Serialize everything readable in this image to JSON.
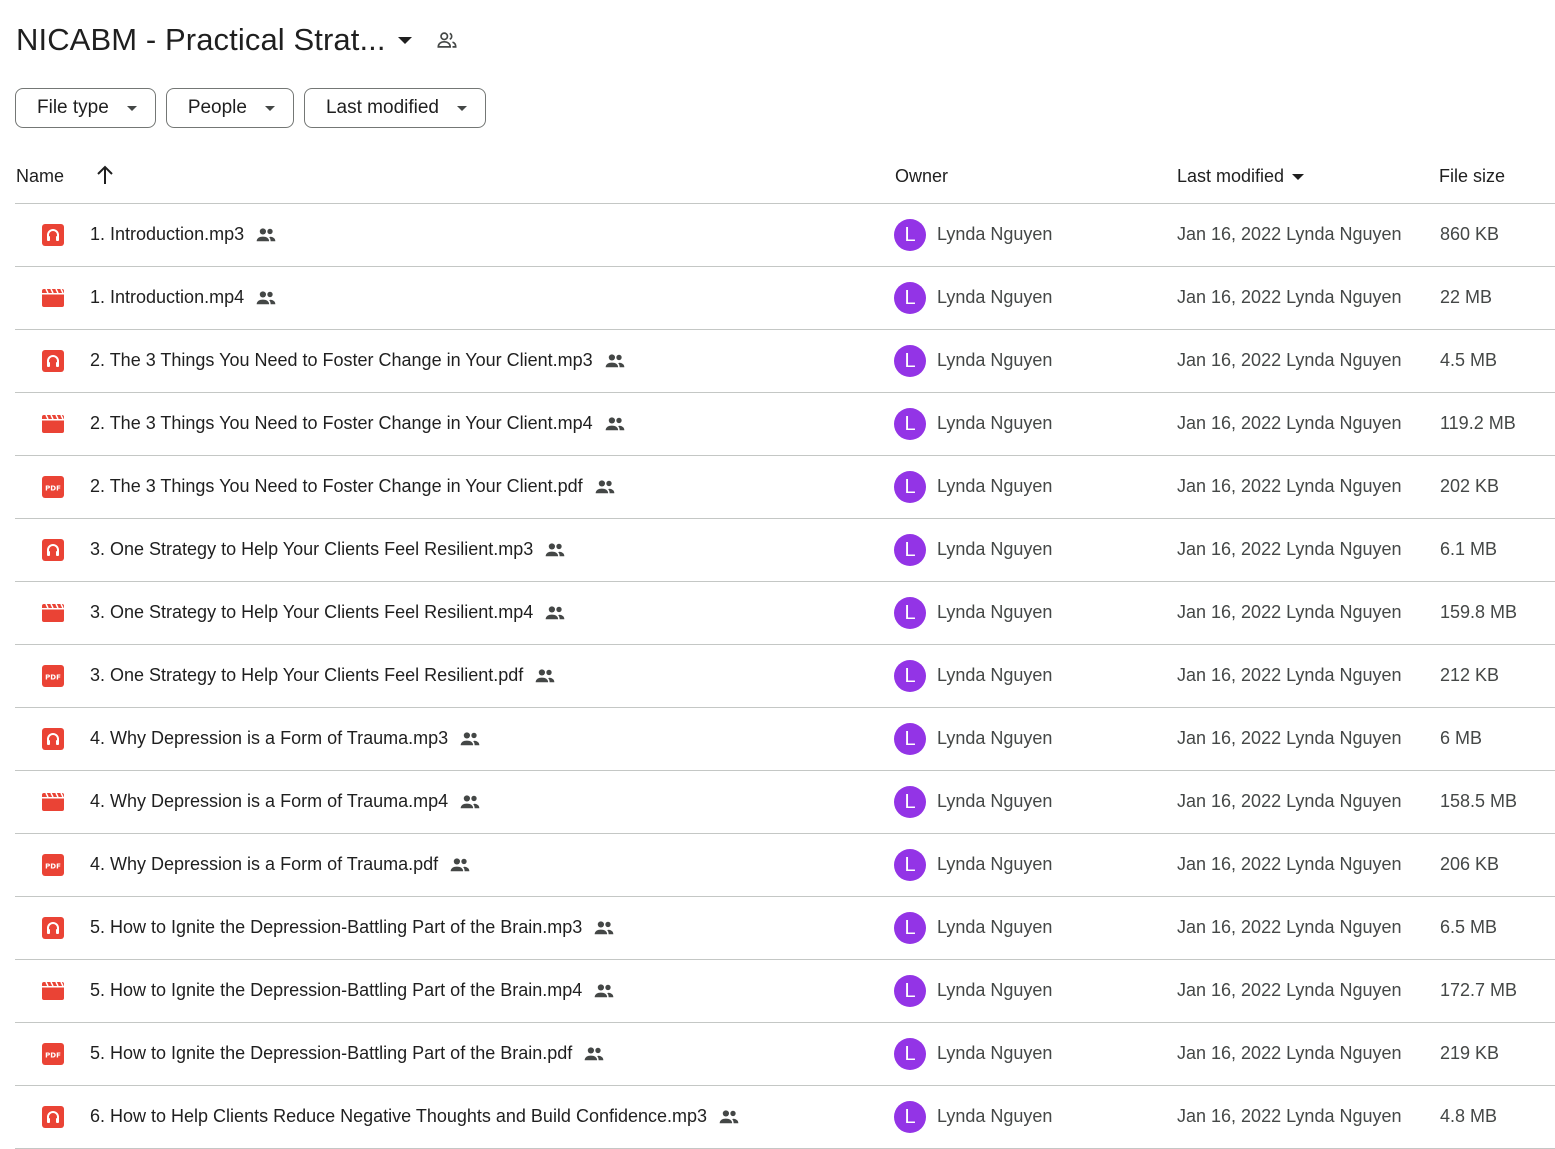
{
  "folder": {
    "title": "NICABM - Practical Strat..."
  },
  "filters": [
    {
      "label": "File type"
    },
    {
      "label": "People"
    },
    {
      "label": "Last modified"
    }
  ],
  "columns": {
    "name": "Name",
    "owner": "Owner",
    "last_modified": "Last modified",
    "file_size": "File size"
  },
  "colors": {
    "accent_red": "#ea4335",
    "avatar_purple": "#9334e6"
  },
  "files": [
    {
      "name": "1. Introduction.mp3",
      "type": "audio",
      "owner_initial": "L",
      "owner": "Lynda Nguyen",
      "modified": "Jan 16, 2022 Lynda Nguyen",
      "size": "860 KB"
    },
    {
      "name": "1. Introduction.mp4",
      "type": "video",
      "owner_initial": "L",
      "owner": "Lynda Nguyen",
      "modified": "Jan 16, 2022 Lynda Nguyen",
      "size": "22 MB"
    },
    {
      "name": "2. The 3 Things You Need to Foster Change in Your Client.mp3",
      "type": "audio",
      "owner_initial": "L",
      "owner": "Lynda Nguyen",
      "modified": "Jan 16, 2022 Lynda Nguyen",
      "size": "4.5 MB"
    },
    {
      "name": "2. The 3 Things You Need to Foster Change in Your Client.mp4",
      "type": "video",
      "owner_initial": "L",
      "owner": "Lynda Nguyen",
      "modified": "Jan 16, 2022 Lynda Nguyen",
      "size": "119.2 MB"
    },
    {
      "name": "2. The 3 Things You Need to Foster Change in Your Client.pdf",
      "type": "pdf",
      "owner_initial": "L",
      "owner": "Lynda Nguyen",
      "modified": "Jan 16, 2022 Lynda Nguyen",
      "size": "202 KB"
    },
    {
      "name": "3. One Strategy to Help Your Clients Feel Resilient.mp3",
      "type": "audio",
      "owner_initial": "L",
      "owner": "Lynda Nguyen",
      "modified": "Jan 16, 2022 Lynda Nguyen",
      "size": "6.1 MB"
    },
    {
      "name": "3. One Strategy to Help Your Clients Feel Resilient.mp4",
      "type": "video",
      "owner_initial": "L",
      "owner": "Lynda Nguyen",
      "modified": "Jan 16, 2022 Lynda Nguyen",
      "size": "159.8 MB"
    },
    {
      "name": "3. One Strategy to Help Your Clients Feel Resilient.pdf",
      "type": "pdf",
      "owner_initial": "L",
      "owner": "Lynda Nguyen",
      "modified": "Jan 16, 2022 Lynda Nguyen",
      "size": "212 KB"
    },
    {
      "name": "4. Why Depression is a Form of Trauma.mp3",
      "type": "audio",
      "owner_initial": "L",
      "owner": "Lynda Nguyen",
      "modified": "Jan 16, 2022 Lynda Nguyen",
      "size": "6 MB"
    },
    {
      "name": "4. Why Depression is a Form of Trauma.mp4",
      "type": "video",
      "owner_initial": "L",
      "owner": "Lynda Nguyen",
      "modified": "Jan 16, 2022 Lynda Nguyen",
      "size": "158.5 MB"
    },
    {
      "name": "4. Why Depression is a Form of Trauma.pdf",
      "type": "pdf",
      "owner_initial": "L",
      "owner": "Lynda Nguyen",
      "modified": "Jan 16, 2022 Lynda Nguyen",
      "size": "206 KB"
    },
    {
      "name": "5. How to Ignite the Depression-Battling Part of the Brain.mp3",
      "type": "audio",
      "owner_initial": "L",
      "owner": "Lynda Nguyen",
      "modified": "Jan 16, 2022 Lynda Nguyen",
      "size": "6.5 MB"
    },
    {
      "name": "5. How to Ignite the Depression-Battling Part of the Brain.mp4",
      "type": "video",
      "owner_initial": "L",
      "owner": "Lynda Nguyen",
      "modified": "Jan 16, 2022 Lynda Nguyen",
      "size": "172.7 MB"
    },
    {
      "name": "5. How to Ignite the Depression-Battling Part of the Brain.pdf",
      "type": "pdf",
      "owner_initial": "L",
      "owner": "Lynda Nguyen",
      "modified": "Jan 16, 2022 Lynda Nguyen",
      "size": "219 KB"
    },
    {
      "name": "6. How to Help Clients Reduce Negative Thoughts and Build Confidence.mp3",
      "type": "audio",
      "owner_initial": "L",
      "owner": "Lynda Nguyen",
      "modified": "Jan 16, 2022 Lynda Nguyen",
      "size": "4.8 MB"
    }
  ]
}
